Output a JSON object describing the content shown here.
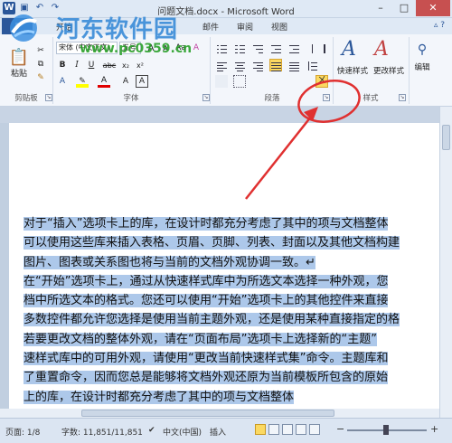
{
  "window": {
    "title": "问题文档.docx - Microsoft Word"
  },
  "watermark": {
    "title": "河东软件园",
    "url": "www.pc0359.cn"
  },
  "tabs": [
    {
      "label": "开始"
    },
    {
      "label": "邮件"
    },
    {
      "label": "审阅"
    },
    {
      "label": "视图"
    }
  ],
  "ribbon": {
    "paste_label": "粘贴",
    "clipboard_group": "剪贴板",
    "font_group": "字体",
    "paragraph_group": "段落",
    "styles_group": "样式",
    "font_name": "宋体 (中文正文)",
    "font_size": "五号",
    "bold": "B",
    "italic": "I",
    "underline": "U",
    "strike": "abc",
    "sub": "x₂",
    "sup": "x²",
    "font_color": "A",
    "grow": "A",
    "shrink": "A",
    "change_case": "Aa",
    "clear_format": "A",
    "quick_styles": "快速样式",
    "change_styles": "更改样式",
    "edit": "编辑"
  },
  "document": {
    "lines": [
      "对于“插入”选项卡上的库，在设计时都充分考虑了其中的项与文档整体",
      "可以使用这些库来插入表格、页眉、页脚、列表、封面以及其他文档构建",
      "图片、图表或关系图也将与当前的文档外观协调一致。↵",
      "在“开始”选项卡上，通过从快速样式库中为所选文本选择一种外观，您",
      "档中所选文本的格式。您还可以使用“开始”选项卡上的其他控件来直接",
      "多数控件都允许您选择是使用当前主题外观，还是使用某种直接指定的格",
      "若要更改文档的整体外观，请在“页面布局”选项卡上选择新的“主题”",
      "速样式库中的可用外观，请使用“更改当前快速样式集”命令。主题库和",
      "了重置命令，因而您总是能够将文档外观还原为当前模板所包含的原始",
      "上的库，在设计时都充分考虑了其中的项与文档整体"
    ]
  },
  "status": {
    "page": "页面: 1/8",
    "words": "字数: 11,851/11,851",
    "language": "中文(中国)",
    "mode": "插入"
  },
  "colors": {
    "accent": "#2b579a",
    "annotation": "#e03030",
    "selection": "#adc8ea"
  }
}
